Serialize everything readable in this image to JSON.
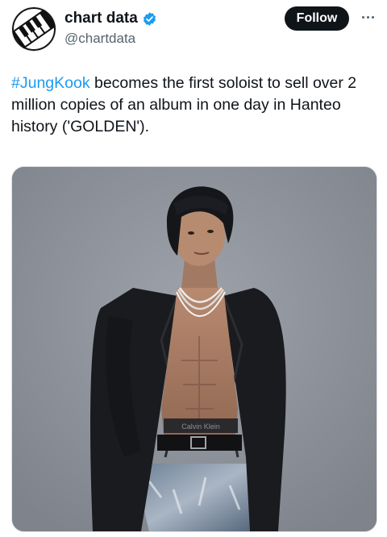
{
  "header": {
    "display_name": "chart data",
    "handle": "@chartdata",
    "follow_label": "Follow",
    "avatar_icon": "piano-keys-logo-icon",
    "verified_icon": "verified-badge-icon",
    "more_icon": "more-dots-icon"
  },
  "tweet": {
    "hashtag": "#JungKook",
    "text": " becomes the first soloist to sell over 2 million copies of an album in one day in Hanteo history ('GOLDEN')."
  },
  "media": {
    "alt": "photo",
    "waistband_text": "Calvin Klein"
  },
  "colors": {
    "accent": "#1d9bf0",
    "follow_bg": "#0f1419",
    "photo_bg": "#8f949c"
  }
}
